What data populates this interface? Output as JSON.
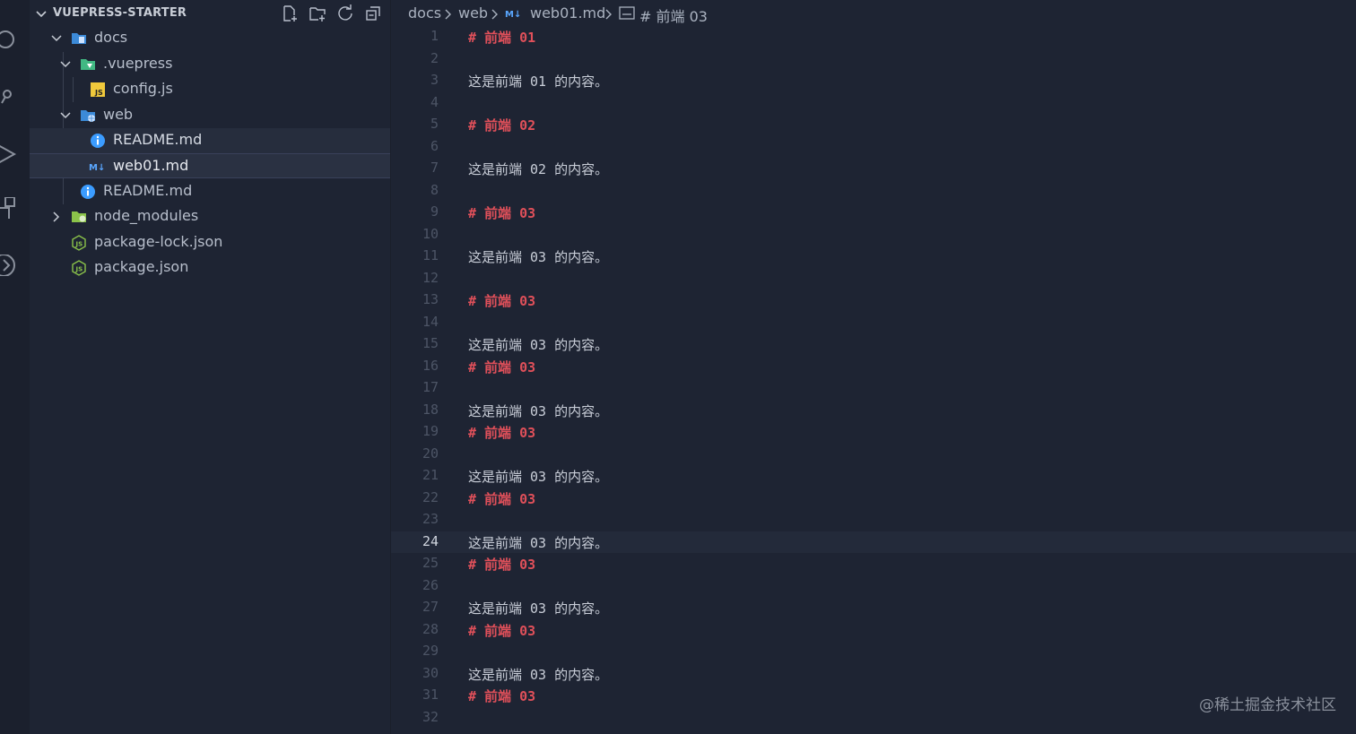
{
  "sidebar": {
    "title": "VUEPRESS-STARTER",
    "actions": [
      {
        "name": "new-file-icon"
      },
      {
        "name": "new-folder-icon"
      },
      {
        "name": "refresh-icon"
      },
      {
        "name": "collapse-all-icon"
      }
    ],
    "tree": [
      {
        "label": "docs",
        "icon": "folder-docs-icon",
        "expanded": true
      },
      {
        "label": ".vuepress",
        "icon": "folder-vuepress-icon",
        "expanded": true
      },
      {
        "label": "config.js",
        "icon": "js-file-icon"
      },
      {
        "label": "web",
        "icon": "folder-web-icon",
        "expanded": true
      },
      {
        "label": "README.md",
        "icon": "info-icon"
      },
      {
        "label": "web01.md",
        "icon": "markdown-icon"
      },
      {
        "label": "README.md",
        "icon": "info-icon"
      },
      {
        "label": "node_modules",
        "icon": "folder-node-icon",
        "expanded": false
      },
      {
        "label": "package-lock.json",
        "icon": "nodejs-icon"
      },
      {
        "label": "package.json",
        "icon": "nodejs-icon"
      }
    ]
  },
  "breadcrumb": {
    "docs": "docs",
    "web": "web",
    "file": "web01.md",
    "symbol": "# 前端 03"
  },
  "editor": {
    "current_line": "24",
    "lines": [
      {
        "n": "1",
        "text": "# 前端 01",
        "kind": "heading"
      },
      {
        "n": "2",
        "text": "",
        "kind": "blank"
      },
      {
        "n": "3",
        "text": "这是前端 01 的内容。",
        "kind": "para"
      },
      {
        "n": "4",
        "text": "",
        "kind": "blank"
      },
      {
        "n": "5",
        "text": "# 前端 02",
        "kind": "heading"
      },
      {
        "n": "6",
        "text": "",
        "kind": "blank"
      },
      {
        "n": "7",
        "text": "这是前端 02 的内容。",
        "kind": "para"
      },
      {
        "n": "8",
        "text": "",
        "kind": "blank"
      },
      {
        "n": "9",
        "text": "# 前端 03",
        "kind": "heading"
      },
      {
        "n": "10",
        "text": "",
        "kind": "blank"
      },
      {
        "n": "11",
        "text": "这是前端 03 的内容。",
        "kind": "para"
      },
      {
        "n": "12",
        "text": "",
        "kind": "blank"
      },
      {
        "n": "13",
        "text": "# 前端 03",
        "kind": "heading"
      },
      {
        "n": "14",
        "text": "",
        "kind": "blank"
      },
      {
        "n": "15",
        "text": "这是前端 03 的内容。",
        "kind": "para"
      },
      {
        "n": "16",
        "text": "# 前端 03",
        "kind": "heading"
      },
      {
        "n": "17",
        "text": "",
        "kind": "blank"
      },
      {
        "n": "18",
        "text": "这是前端 03 的内容。",
        "kind": "para"
      },
      {
        "n": "19",
        "text": "# 前端 03",
        "kind": "heading"
      },
      {
        "n": "20",
        "text": "",
        "kind": "blank"
      },
      {
        "n": "21",
        "text": "这是前端 03 的内容。",
        "kind": "para"
      },
      {
        "n": "22",
        "text": "# 前端 03",
        "kind": "heading"
      },
      {
        "n": "23",
        "text": "",
        "kind": "blank"
      },
      {
        "n": "24",
        "text": "这是前端 03 的内容。",
        "kind": "para"
      },
      {
        "n": "25",
        "text": "# 前端 03",
        "kind": "heading"
      },
      {
        "n": "26",
        "text": "",
        "kind": "blank"
      },
      {
        "n": "27",
        "text": "这是前端 03 的内容。",
        "kind": "para"
      },
      {
        "n": "28",
        "text": "# 前端 03",
        "kind": "heading"
      },
      {
        "n": "29",
        "text": "",
        "kind": "blank"
      },
      {
        "n": "30",
        "text": "这是前端 03 的内容。",
        "kind": "para"
      },
      {
        "n": "31",
        "text": "# 前端 03",
        "kind": "heading"
      },
      {
        "n": "32",
        "text": "",
        "kind": "blank"
      }
    ]
  },
  "watermark": "@稀土掘金技术社区",
  "colors": {
    "heading": "#e0505a",
    "background": "#1e2433",
    "text": "#c9ced8"
  }
}
